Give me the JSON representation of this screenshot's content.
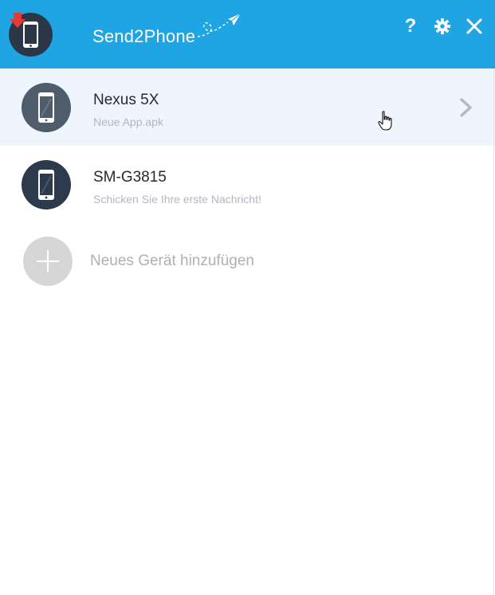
{
  "app": {
    "title": "Send2Phone",
    "accent_color": "#1fa5e3"
  },
  "header": {
    "help_label": "?",
    "icons": [
      "app-logo-icon",
      "paper-plane-icon",
      "help-icon",
      "gear-icon",
      "close-icon"
    ]
  },
  "devices": [
    {
      "name": "Nexus 5X",
      "subtitle": "Neue App.apk",
      "selected": true,
      "icon": "smartphone-icon"
    },
    {
      "name": "SM-G3815",
      "subtitle": "Schicken Sie Ihre erste Nachricht!",
      "selected": false,
      "icon": "smartphone-icon"
    }
  ],
  "add_device": {
    "label": "Neues Gerät hinzufügen",
    "icon": "plus-icon"
  }
}
